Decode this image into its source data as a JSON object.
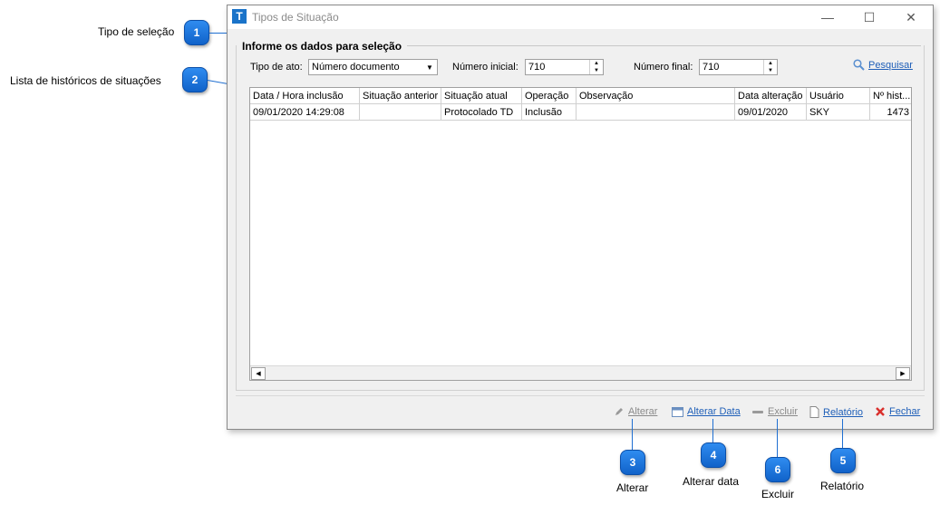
{
  "callouts": [
    {
      "num": "1",
      "label": "Tipo de seleção"
    },
    {
      "num": "2",
      "label": "Lista de históricos de situações"
    },
    {
      "num": "3",
      "label": "Alterar"
    },
    {
      "num": "4",
      "label": "Alterar data"
    },
    {
      "num": "6",
      "label": "Excluir"
    },
    {
      "num": "5",
      "label": "Relatório"
    }
  ],
  "window": {
    "icon_letter": "T",
    "title": "Tipos de Situação",
    "minimize": "—",
    "maximize": "☐",
    "close": "✕"
  },
  "form": {
    "group_title": "Informe os dados para seleção",
    "tipo_label": "Tipo de ato:",
    "tipo_value": "Número documento",
    "numero_inicial_label": "Número inicial:",
    "numero_inicial_value": "710",
    "numero_final_label": "Número final:",
    "numero_final_value": "710",
    "search_label": "Pesquisar"
  },
  "grid": {
    "columns": [
      "Data / Hora inclusão",
      "Situação anterior",
      "Situação atual",
      "Operação",
      "Observação",
      "Data alteração",
      "Usuário",
      "Nº hist..."
    ],
    "rows": [
      [
        "09/01/2020 14:29:08",
        "",
        "Protocolado TD",
        "Inclusão",
        "",
        "09/01/2020",
        "SKY",
        "1473"
      ]
    ]
  },
  "actions": {
    "alterar": "Alterar",
    "alterar_data": "Alterar Data",
    "excluir": "Excluir",
    "relatorio": "Relatório",
    "fechar": "Fechar"
  },
  "colors": {
    "accent": "#1f6fd1",
    "link": "#1f5fb8",
    "close_red": "#d9302c"
  }
}
